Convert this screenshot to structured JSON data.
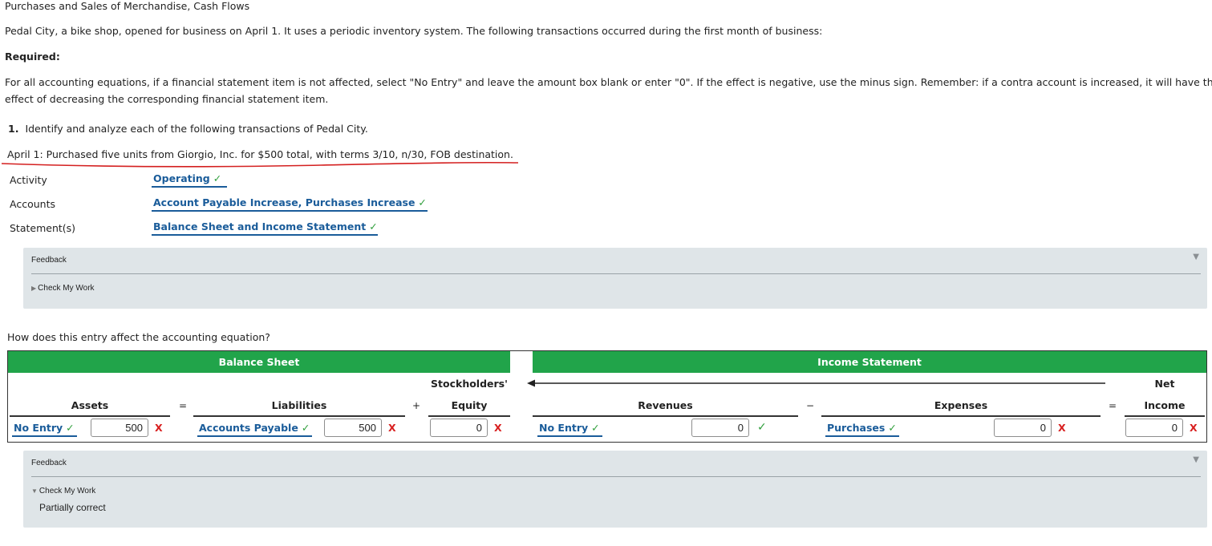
{
  "page_title": "Purchases and Sales of Merchandise, Cash Flows",
  "intro": "Pedal City, a bike shop, opened for business on April 1. It uses a periodic inventory system. The following transactions occurred during the first month of business:",
  "required_label": "Required:",
  "instructions_line1": "For all accounting equations, if a financial statement item is not affected, select \"No Entry\" and leave the amount box blank or enter \"0\". If the effect is negative, use the minus sign. Remember: if a contra account is increased, it will have the",
  "instructions_line2": "effect of decreasing the corresponding financial statement item.",
  "question_number": "1.",
  "question_text": "Identify and analyze each of the following transactions of Pedal City.",
  "transaction": "April 1: Purchased five units from Giorgio, Inc. for $500 total, with terms 3/10, n/30, FOB destination.",
  "analysis": {
    "activity_label": "Activity",
    "activity_value": "Operating",
    "accounts_label": "Accounts",
    "accounts_value": "Account Payable Increase, Purchases Increase",
    "statements_label": "Statement(s)",
    "statements_value": "Balance Sheet and Income Statement"
  },
  "feedback1": {
    "title": "Feedback",
    "check_label": "Check My Work",
    "caret": "▼",
    "expanded": false
  },
  "equation_question": "How does this entry affect the accounting equation?",
  "equation": {
    "balance_sheet_header": "Balance Sheet",
    "income_statement_header": "Income Statement",
    "stockholders_label": "Stockholders'",
    "equity_label": "Equity",
    "assets_label": "Assets",
    "liabilities_label": "Liabilities",
    "revenues_label": "Revenues",
    "expenses_label": "Expenses",
    "net_label": "Net",
    "income_label": "Income",
    "eq_sign": "=",
    "plus_sign": "+",
    "minus_sign": "−",
    "assets_select": "No Entry",
    "assets_amount": "500",
    "assets_status": "incorrect",
    "liabilities_select": "Accounts Payable",
    "liabilities_amount": "500",
    "liabilities_status": "incorrect",
    "equity_amount": "0",
    "equity_status": "incorrect",
    "revenues_select": "No Entry",
    "revenues_amount": "0",
    "revenues_status": "correct",
    "expenses_select": "Purchases",
    "expenses_amount": "0",
    "expenses_status": "incorrect",
    "net_income_amount": "0",
    "net_income_status": "incorrect"
  },
  "feedback2": {
    "title": "Feedback",
    "check_label": "Check My Work",
    "caret": "▼",
    "expanded": true,
    "result": "Partially correct"
  },
  "marks": {
    "check": "✓",
    "cross": "X"
  },
  "colors": {
    "green_header": "#21a44a",
    "answer_blue": "#1a5c9a",
    "check_green": "#2e9e3a",
    "cross_red": "#d81f1f",
    "feedback_bg": "#dfe5e8",
    "annotation_red": "#d42020"
  }
}
